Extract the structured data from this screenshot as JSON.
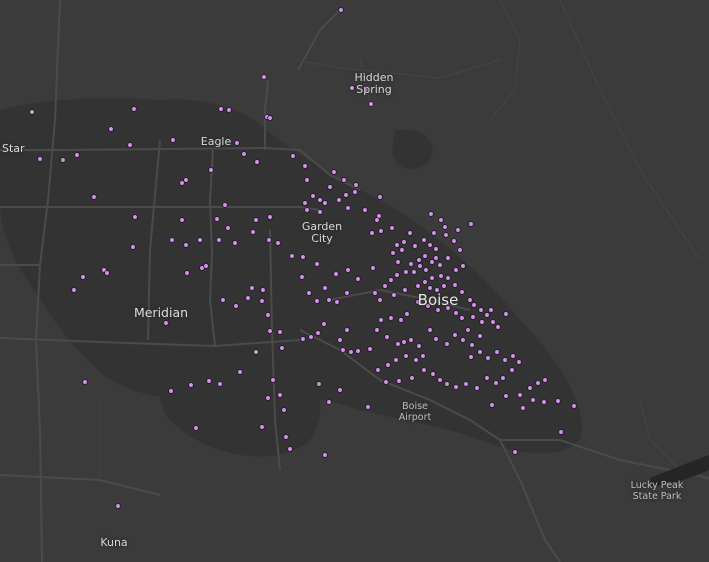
{
  "map": {
    "colors": {
      "background": "#3b3b3b",
      "urban": "#333333",
      "road": "#4b4b4b",
      "point_fill": "#d98ff2",
      "point_stroke": "#1e1e1e"
    },
    "labels": {
      "hidden_spring": "Hidden\nSpring",
      "star": "Star",
      "eagle": "Eagle",
      "garden_city": "Garden\nCity",
      "boise": "Boise",
      "meridian": "Meridian",
      "boise_airport": "Boise\nAirport",
      "lucky_peak": "Lucky Peak\nState Park",
      "kuna": "Kuna"
    }
  }
}
